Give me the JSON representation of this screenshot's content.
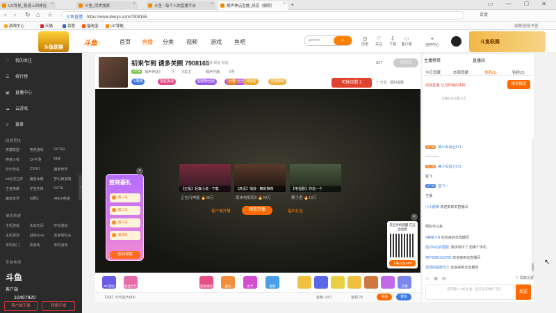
{
  "browser": {
    "tabs": [
      {
        "label": "UC导航_极速上网体验"
      },
      {
        "label": "斗鱼_同类搜索"
      },
      {
        "label": "斗鱼 - 每个人的直播平台"
      },
      {
        "label": "相声神话直播_频道（偏照）"
      }
    ],
    "url_site": "斗鱼直播",
    "url": "https://www.douyu.com/7908165",
    "search_label": "百度",
    "bookmarks": [
      "游戏中心",
      "天猫",
      "百度",
      "福淘宝",
      "UC导航"
    ],
    "bookmark_right": "收藏/获取书签"
  },
  "header": {
    "logo_text": "斗鱼联赛",
    "site_logo": "斗鱼",
    "nav": [
      "首页",
      "直播",
      "分类",
      "视频",
      "游戏",
      "鱼吧"
    ],
    "search_placeholder": "gemini",
    "icons": [
      "历史",
      "关注",
      "下载",
      "客户端",
      "创作中心"
    ],
    "banner_text": "斗鱼联赛"
  },
  "sidebar": {
    "items": [
      "我的关注",
      "排行榜",
      "直播中心",
      "云游戏",
      "赛事"
    ],
    "sections": [
      {
        "title": "网游竞技",
        "items": [
          "英雄联盟",
          "电竞游戏",
          "DOTA2",
          "穿越火线",
          "CF手游",
          "DNF",
          "炉石传说",
          "CSGO",
          "魔兽世界",
          "lol云顶之弈",
          "魔兽争霸",
          "梦幻西游端",
          "王者荣耀",
          "守望先锋",
          "DOTA",
          "魔兽世界",
          "剑网3",
          "APEX英雄"
        ]
      },
      {
        "title": "单机热游",
        "items": [
          "主机游戏",
          "永劫无间",
          "怀旧游戏",
          "主机游戏",
          "战地2042",
          "逃离塔科夫",
          "单机热门",
          "新游戏",
          "单机游戏"
        ]
      },
      {
        "title": "手游休闲",
        "items": [
          "王者荣耀",
          "和平精英",
          "火影忍者"
        ]
      }
    ],
    "brand": "斗鱼",
    "brand_sub": "客户端",
    "phone": "10407920",
    "btn_client": "客户端下载",
    "btn_live": "我要开播"
  },
  "room": {
    "title": "初来乍到 请多关照 7908165",
    "tags": "举报  频道  频道",
    "meta": [
      "LV34",
      "相声神话3",
      "11",
      "0关注",
      "相声开播",
      "5号"
    ],
    "follow_count": "627",
    "follow_label": "已关注",
    "badges": [
      "V周榜",
      "福星挑战",
      "超级粉丝团",
      "超级粉丝团",
      "分榜",
      "24连胜",
      "贵族榜单"
    ],
    "lucky": "可抽次数 2",
    "share": "分享",
    "report": "福利提醒"
  },
  "video": {
    "cards": [
      {
        "caption": "【正版】轻森小说 - 下载",
        "meta": "正在问神屋",
        "views": "65万"
      },
      {
        "caption": "【高清】播放 - 精彩推荐",
        "meta": "周末电影院2",
        "views": "24万"
      },
      {
        "caption": "【电视剧】你追一个",
        "meta": "赛子君",
        "views": "13万"
      }
    ],
    "link_left": "客户端开播",
    "open_btn": "网页开播",
    "link_right": "福利礼包",
    "sign_title": "签到豪礼",
    "sign_rows": [
      "第一天",
      "第二天",
      "第三天",
      "第四天"
    ],
    "sign_btn": "签到领取",
    "qr_title": "开启手机提醒 在这边边看",
    "qr_btn": "下载斗鱼APP"
  },
  "gifts": {
    "labels": [
      "PK活动",
      "粉丝大厅",
      "超级福袋",
      "鱼丸",
      "办卡",
      "福利",
      "礼物"
    ],
    "bottom": [
      "【1级】你可能大侠K!",
      "鱼粮 1051",
      "鱼翅 29",
      "充值"
    ],
    "btn1": "充值",
    "btn2": "背包"
  },
  "right": {
    "host_tab": "主播榜单",
    "live_tab": "直播间",
    "tabs": [
      "今日贡献",
      "本周贡献",
      "贵宾(1)",
      "钻粉(2)"
    ],
    "promo": "成就直播, 让领你做的事情",
    "join_btn": "报名报道",
    "note": "主播尚未设置公告",
    "messages": [
      {
        "lv": "LV 35",
        "name": "美少女战士571:",
        "text": ""
      },
      {
        "lv": "",
        "name": "",
        "text": "————"
      },
      {
        "lv": "LV 29",
        "name": "美少女战士571:",
        "text": ""
      },
      {
        "lv": "",
        "name": "",
        "text": "首飞"
      },
      {
        "lv": "LV 30",
        "name": "首飞 ~",
        "text": ""
      },
      {
        "lv": "",
        "name": "",
        "text": "主播"
      },
      {
        "lv": "",
        "name": "小小欧美",
        "text": "欢迎来到本直播间"
      },
      {
        "lv": "",
        "name": "",
        "text": "朋友可以来"
      },
      {
        "lv": "",
        "name": "9等级人N",
        "text": "欢迎来到本直播间"
      },
      {
        "lv": "",
        "name": "借JDo内衣眉酸:",
        "text": "我手机坏了 想换个手机"
      },
      {
        "lv": "",
        "name": "用户8081633785",
        "text": "欢迎来到本直播间"
      },
      {
        "lv": "",
        "name": "道现的品牌为土",
        "text": "欢迎来到本直播间"
      }
    ],
    "input_placeholder": "还有输入 #关注:发一些写过去更好 又打",
    "send": "发送",
    "shield": "屏蔽设置"
  }
}
